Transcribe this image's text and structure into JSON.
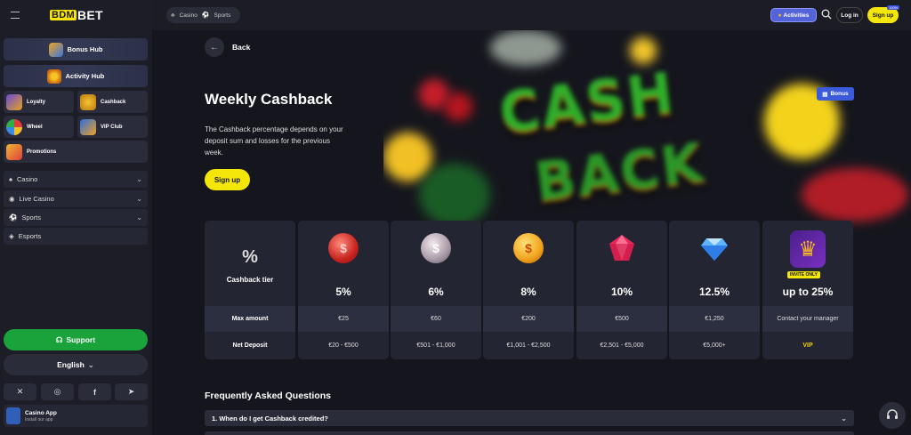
{
  "brand": {
    "logo_a": "BDM",
    "logo_b": "BET"
  },
  "sidebar": {
    "bonus_hub": "Bonus Hub",
    "activity_hub": "Activity Hub",
    "tiles": [
      "Loyalty",
      "Cashback",
      "Wheel",
      "VIP Club"
    ],
    "promotions": "Promotions",
    "nav": [
      "Casino",
      "Live Casino",
      "Sports",
      "Esports"
    ],
    "support": "Support",
    "language": "English",
    "app_title": "Casino App",
    "app_sub": "Install our app"
  },
  "topbar": {
    "tab_casino": "Casino",
    "tab_sports": "Sports",
    "activities": "Activities",
    "login": "Log in",
    "signup": "Sign up",
    "signup_badge": "100%"
  },
  "page": {
    "back": "Back",
    "title": "Weekly Cashback",
    "description": "The Cashback percentage depends on your deposit sum and losses for the previous week.",
    "signup": "Sign up",
    "bonus_tag": "Bonus"
  },
  "table": {
    "header": {
      "icon": "%",
      "label": "Cashback tier",
      "row1": "Max amount",
      "row2": "Net Deposit"
    },
    "tiers": [
      {
        "icon": "red-coin",
        "pct": "5%",
        "max": "€25",
        "deposit": "€20 - €500"
      },
      {
        "icon": "silver-coin",
        "pct": "6%",
        "max": "€60",
        "deposit": "€501 - €1,000"
      },
      {
        "icon": "gold-coin",
        "pct": "8%",
        "max": "€200",
        "deposit": "€1,001 - €2,500"
      },
      {
        "icon": "ruby-gem",
        "pct": "10%",
        "max": "€500",
        "deposit": "€2,501 - €5,000"
      },
      {
        "icon": "diamond-gem",
        "pct": "12.5%",
        "max": "€1,250",
        "deposit": "€5,000+"
      },
      {
        "icon": "crown",
        "badge": "INVITE ONLY",
        "pct": "up to 25%",
        "max": "Contact your manager",
        "deposit": "VIP"
      }
    ]
  },
  "faq": {
    "title": "Frequently Asked Questions",
    "q1": "1.  When do I get Cashback credited?"
  },
  "colors": {
    "accent_yellow": "#f5e60a",
    "support_green": "#1aa33a",
    "vip_yellow": "#f5d10a"
  }
}
